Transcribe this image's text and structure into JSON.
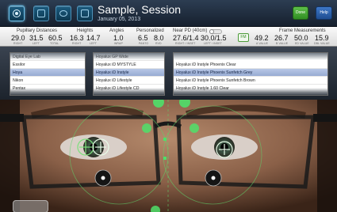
{
  "header": {
    "title": "Sample, Session",
    "date": "January 05, 2013",
    "done_label": "Done",
    "help_label": "Help",
    "toolbar_icons": [
      "target-icon",
      "frame-icon",
      "lens-icon",
      "zoom-icon"
    ]
  },
  "measurements": {
    "pupillary_distances": {
      "title": "Pupillary Distances",
      "values": [
        {
          "value": "29.0",
          "label": "RIGHT"
        },
        {
          "value": "31.5",
          "label": "LEFT"
        },
        {
          "value": "60.5",
          "label": "TOTAL"
        }
      ]
    },
    "heights": {
      "title": "Heights",
      "values": [
        {
          "value": "16.3",
          "label": "RIGHT"
        },
        {
          "value": "14.7",
          "label": "LEFT"
        }
      ]
    },
    "angles": {
      "title": "Angles",
      "values": [
        {
          "value": "1.0",
          "label": "WRAP"
        }
      ]
    },
    "personalized": {
      "title": "Personalized",
      "values": [
        {
          "value": "6.5",
          "label": "PANTO"
        },
        {
          "value": "8.0",
          "label": "RVD"
        }
      ]
    },
    "near_pd": {
      "title": "Near PD (40cm)",
      "values": [
        {
          "value": "27.6/1.4",
          "label": "RIGHT / INSET"
        },
        {
          "value": "30.0/1.5",
          "label": "LEFT / INSET"
        }
      ]
    },
    "fm_label": "FM",
    "frame_measurements": {
      "title": "Frame Measurements",
      "values": [
        {
          "value": "49.2",
          "label": "A VALUE"
        },
        {
          "value": "26.7",
          "label": "B VALUE"
        },
        {
          "value": "50.0",
          "label": "ED VALUE"
        },
        {
          "value": "15.9",
          "label": "DBL VALUE"
        }
      ]
    }
  },
  "lists": {
    "lab": {
      "items": [
        "Digital Eye Lab",
        "Essilor",
        "Hoya",
        "Nikon",
        "Pentax"
      ],
      "selected": 2
    },
    "series": {
      "items": [
        "Hoyalux GP Wide",
        "Hoyalux iD MYSTYLE",
        "Hoyalux iD Instyle",
        "Hoyalux iD Lifestyle",
        "Hoyalux iD Lifestyle CD"
      ],
      "selected": 2
    },
    "lens": {
      "items": [
        "Hoyalux iD Instyle Phoenix Clear",
        "Hoyalux iD Instyle Phoenix Sunfetch Grey",
        "Hoyalux iD Instyle Phoenix Sunfetch Brown",
        "Hoyalux iD Instyle 1.60 Clear"
      ],
      "selected": 1
    }
  },
  "colors": {
    "accent_blue": "#1c5c80",
    "done_green": "#3fa52f",
    "help_blue": "#2e63ad",
    "selection": "#a8b9de",
    "overlay_green": "#5fd46a"
  }
}
